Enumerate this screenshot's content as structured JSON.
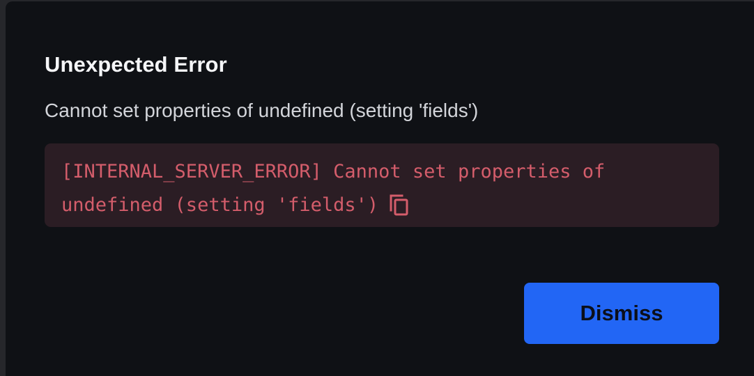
{
  "dialog": {
    "title": "Unexpected Error",
    "message": "Cannot set properties of undefined (setting 'fields')",
    "error_detail": "[INTERNAL_SERVER_ERROR] Cannot set properties of undefined (setting 'fields')",
    "copy_icon": "copy-icon",
    "dismiss_label": "Dismiss"
  },
  "colors": {
    "background": "#0f1115",
    "error_box": "#2b1d24",
    "error_text": "#d45d6b",
    "accent": "#2266f5"
  }
}
